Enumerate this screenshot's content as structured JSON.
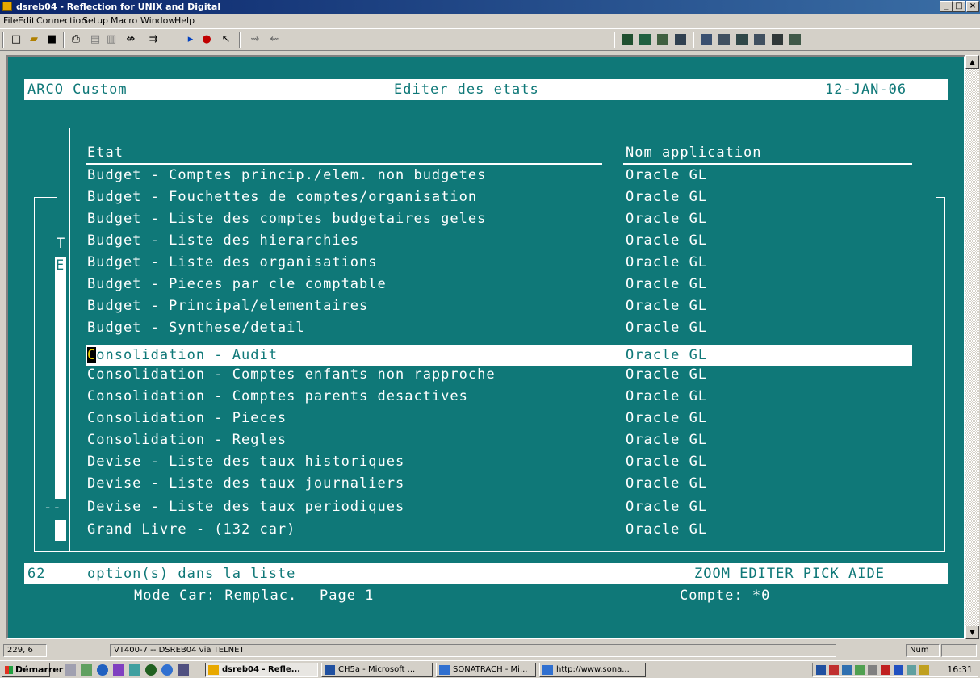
{
  "window": {
    "title": "dsreb04 - Reflection for UNIX and Digital",
    "controls": [
      "_",
      "□",
      "×"
    ]
  },
  "menu": [
    "File",
    "Edit",
    "Connection",
    "Setup",
    "Macro",
    "Window",
    "Help"
  ],
  "terminal": {
    "header": {
      "left": "ARCO Custom",
      "center": "Editer des etats",
      "right": "12-JAN-06"
    },
    "columns": {
      "report": "Etat",
      "application": "Nom application"
    },
    "rows": [
      {
        "report": "Budget - Comptes princip./elem. non budgetes",
        "app": "Oracle GL"
      },
      {
        "report": "Budget - Fouchettes de comptes/organisation",
        "app": "Oracle GL"
      },
      {
        "report": "Budget - Liste des comptes budgetaires geles",
        "app": "Oracle GL"
      },
      {
        "report": "Budget - Liste des hierarchies",
        "app": "Oracle GL"
      },
      {
        "report": "Budget - Liste des organisations",
        "app": "Oracle GL"
      },
      {
        "report": "Budget - Pieces par cle comptable",
        "app": "Oracle GL"
      },
      {
        "report": "Budget - Principal/elementaires",
        "app": "Oracle GL"
      },
      {
        "report": "Budget - Synthese/detail",
        "app": "Oracle GL"
      },
      {
        "report": "Consolidation - Audit",
        "report_cursor": "C",
        "report_rest": "onsolidation - Audit",
        "app": "Oracle GL",
        "selected": true
      },
      {
        "report": "Consolidation - Comptes enfants non rapproche",
        "app": "Oracle GL"
      },
      {
        "report": "Consolidation - Comptes parents desactives",
        "app": "Oracle GL"
      },
      {
        "report": "Consolidation - Pieces",
        "app": "Oracle GL"
      },
      {
        "report": "Consolidation - Regles",
        "app": "Oracle GL"
      },
      {
        "report": "Devise - Liste des taux historiques",
        "app": "Oracle GL"
      },
      {
        "report": "Devise - Liste des taux journaliers",
        "app": "Oracle GL"
      },
      {
        "report": "Devise - Liste des taux periodiques",
        "app": "Oracle GL"
      },
      {
        "report": "Grand Livre - (132 car)",
        "app": "Oracle GL"
      }
    ],
    "side_letters": [
      "T",
      "E"
    ],
    "side_dashes": "--",
    "footer": {
      "count": "62",
      "count_text": "option(s) dans la liste",
      "actions": "ZOOM EDITER PICK AIDE",
      "mode": "Mode Car: Remplac.",
      "page": "Page 1",
      "compte": "Compte: *0"
    }
  },
  "statusbar": {
    "cursor_pos": "229, 6",
    "connection": "VT400-7 -- DSREB04 via TELNET",
    "num": "Num"
  },
  "taskbar": {
    "start": "Démarrer",
    "tasks": [
      "dsreb04 - Refle...",
      "CH5a - Microsoft ...",
      "SONATRACH - Mi...",
      "http://www.sona..."
    ],
    "clock": "16:31"
  },
  "colors": {
    "terminal_bg": "#0f7878",
    "titlebar": "#0a246a"
  }
}
